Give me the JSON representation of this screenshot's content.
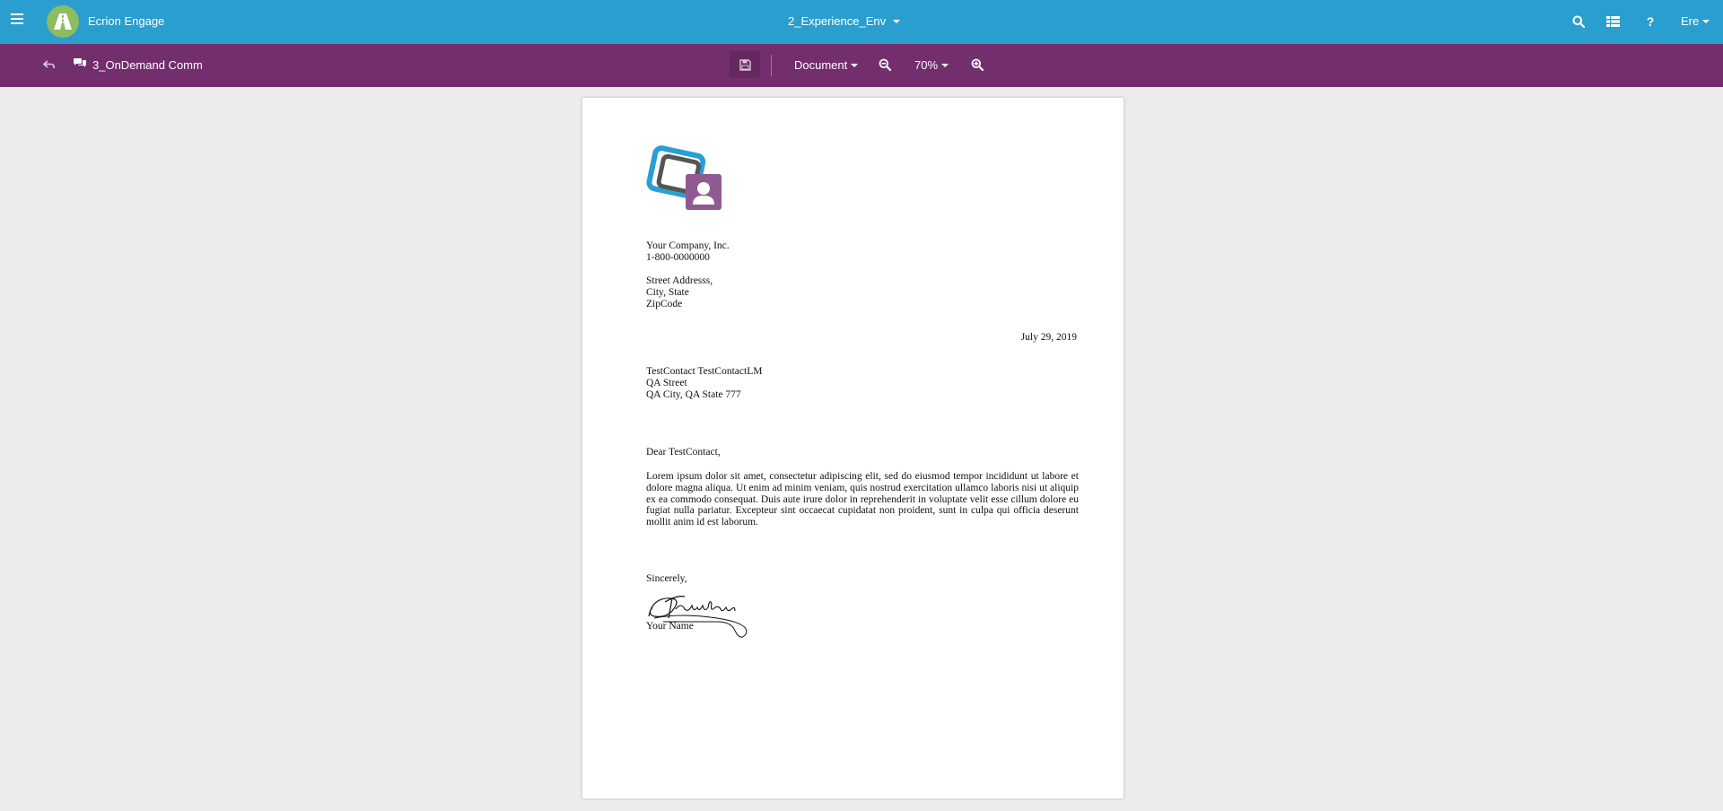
{
  "topbar": {
    "app_title": "Ecrion Engage",
    "environment": "2_Experience_Env",
    "user": "Ere",
    "icons": [
      "menu-icon",
      "search-icon",
      "grid-icon",
      "help-icon"
    ]
  },
  "subbar": {
    "communication_title": "3_OnDemand Comm",
    "view_mode": "Document",
    "zoom_level": "70%",
    "icons": [
      "back-icon",
      "comments-icon",
      "save-icon",
      "zoom-out-icon",
      "zoom-in-icon"
    ]
  },
  "document": {
    "company": {
      "name": "Your Company, Inc.",
      "phone": "1-800-0000000"
    },
    "address": {
      "street": "Street Addresss,",
      "city_state": "City, State",
      "zip": "ZipCode"
    },
    "date": "July 29, 2019",
    "recipient": {
      "name": "TestContact TestContactLM",
      "street": "QA Street",
      "city": "QA City, QA State 777"
    },
    "greeting": "Dear TestContact,",
    "body": "Lorem ipsum dolor sit amet, consectetur adipiscing elit, sed do eiusmod tempor incididunt ut labore et dolore magna aliqua. Ut enim ad minim veniam, quis nostrud exercitation ullamco laboris nisi ut aliquip ex ea commodo consequat. Duis aute irure dolor in reprehenderit in voluptate velit esse cillum dolore eu fugiat nulla pariatur. Excepteur sint occaecat cupidatat non proident, sunt in culpa qui officia deserunt mollit anim id est laborum.",
    "closing": "Sincerely,",
    "signature_text": "B Franklin",
    "signer": "Your Name"
  },
  "colors": {
    "topbar": "#2a9fcf",
    "subbar": "#722e6d",
    "logo_green": "#8dbd5f",
    "doc_logo_blue": "#2a9fd6",
    "doc_logo_purple": "#8f5a91"
  }
}
